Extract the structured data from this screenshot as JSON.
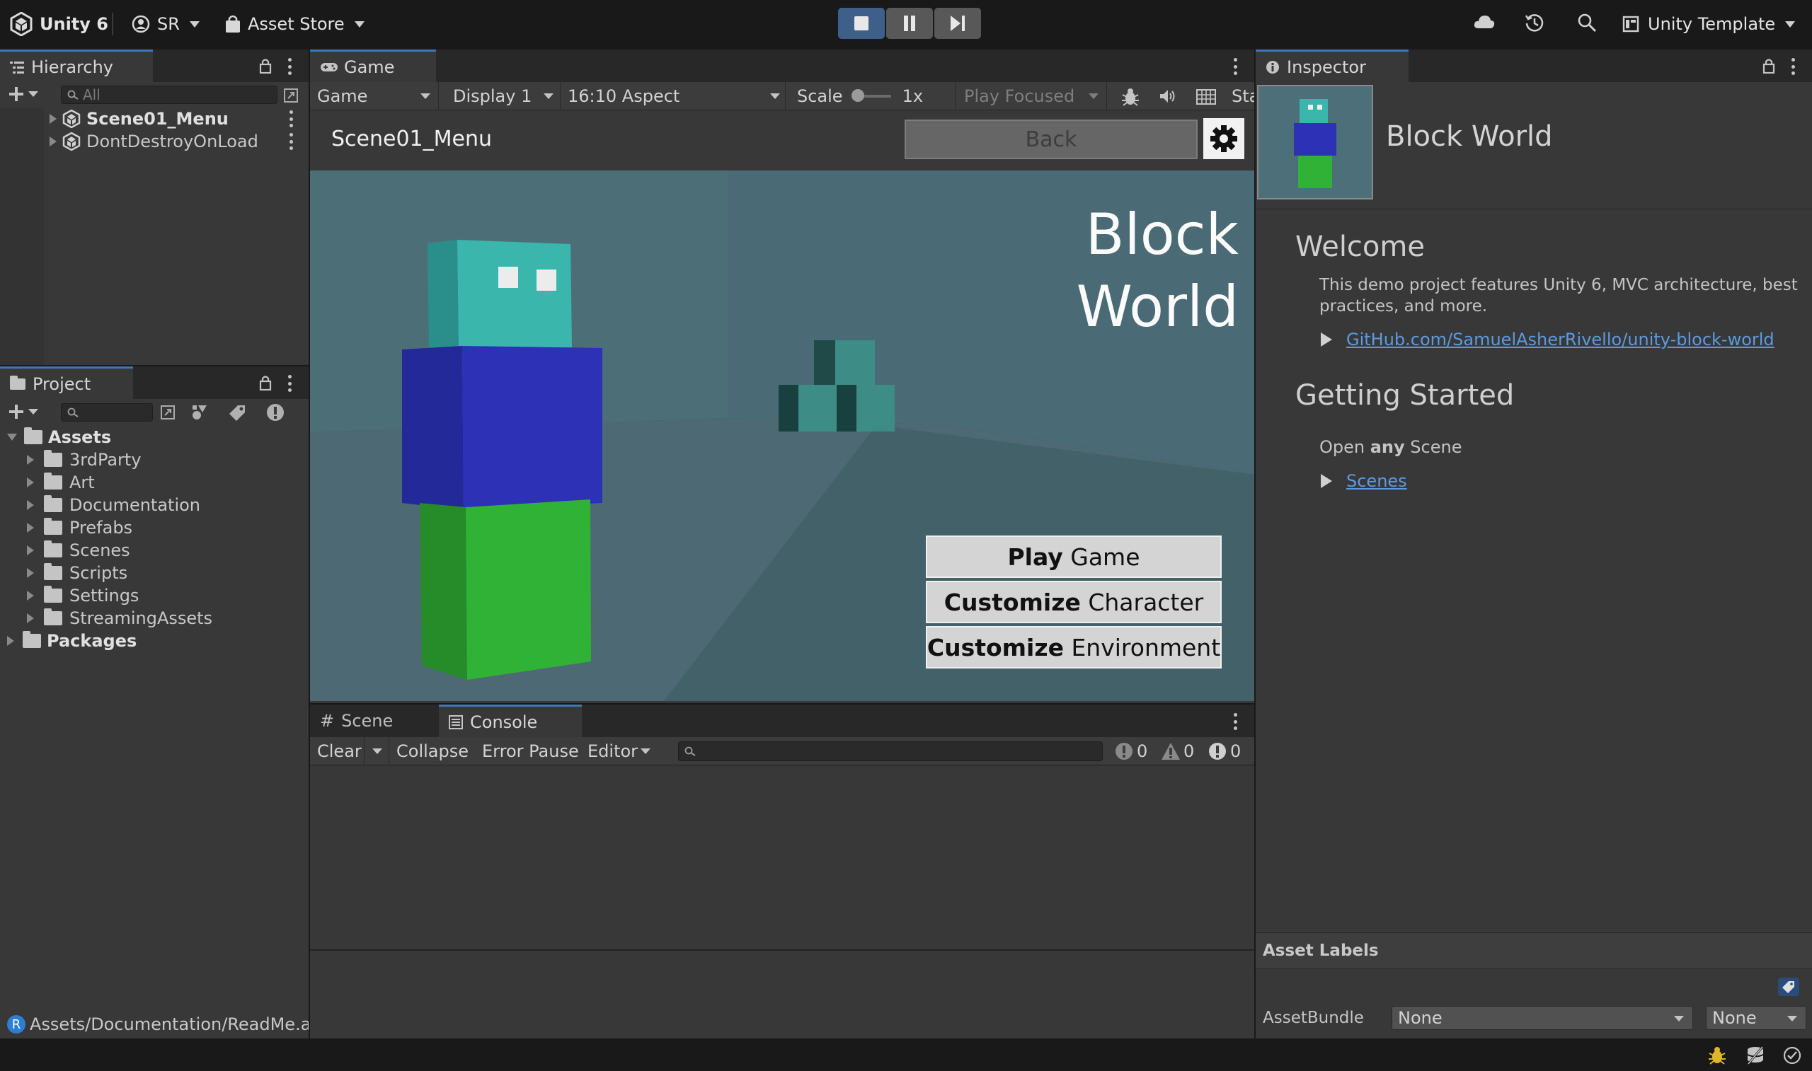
{
  "toolbar": {
    "app_name": "Unity 6",
    "account": "SR",
    "asset_store": "Asset Store",
    "layout": "Unity Template",
    "icons": [
      "unity-logo-icon",
      "account-icon",
      "asset-store-icon",
      "play-icon",
      "pause-icon",
      "step-icon",
      "cloud-icon",
      "history-icon",
      "search-icon",
      "layout-icon"
    ]
  },
  "hierarchy": {
    "tab": "Hierarchy",
    "search_placeholder": "All",
    "items": [
      {
        "label": "Scene01_Menu"
      },
      {
        "label": "DontDestroyOnLoad"
      }
    ]
  },
  "project": {
    "tab": "Project",
    "tree": [
      {
        "label": "Assets"
      },
      {
        "label": "3rdParty"
      },
      {
        "label": "Art"
      },
      {
        "label": "Documentation"
      },
      {
        "label": "Prefabs"
      },
      {
        "label": "Scenes"
      },
      {
        "label": "Scripts"
      },
      {
        "label": "Settings"
      },
      {
        "label": "StreamingAssets"
      },
      {
        "label": "Packages"
      }
    ],
    "status_path": "Assets/Documentation/ReadMe.as",
    "status_badge": "R"
  },
  "game": {
    "tab": "Game",
    "view_dropdown": "Game",
    "display": "Display 1",
    "aspect": "16:10 Aspect",
    "scale_label": "Scale",
    "scale_value": "1x",
    "play_focused": "Play Focused",
    "stats": "Sta",
    "scene_name": "Scene01_Menu",
    "back_label": "Back",
    "title_line1": "Block",
    "title_line2": "World",
    "buttons": [
      {
        "bold": "Play",
        "rest": " Game"
      },
      {
        "bold": "Customize",
        "rest": " Character"
      },
      {
        "bold": "Customize",
        "rest": " Environment"
      }
    ],
    "colors": {
      "head": "#3ab6ad",
      "body": "#2a2fae",
      "legs": "#2fae34",
      "sky": "#4c6f7a"
    }
  },
  "console": {
    "tabs": [
      "Scene",
      "Console"
    ],
    "clear": "Clear",
    "collapse": "Collapse",
    "error_pause": "Error Pause",
    "editor": "Editor",
    "counts": [
      "0",
      "0",
      "0"
    ]
  },
  "inspector": {
    "tab": "Inspector",
    "asset_title": "Block World",
    "welcome_heading": "Welcome",
    "welcome_text": "This demo project features Unity 6, MVC architecture, best practices, and more.",
    "github_link": "GitHub.com/SamuelAsherRivello/unity-block-world",
    "getting_started_heading": "Getting Started",
    "open_text_1": "Open ",
    "open_text_bold": "any",
    "open_text_2": " Scene",
    "scenes_link": "Scenes",
    "asset_labels": "Asset Labels",
    "assetbundle_label": "AssetBundle",
    "assetbundle_value": "None",
    "variant_value": "None"
  }
}
